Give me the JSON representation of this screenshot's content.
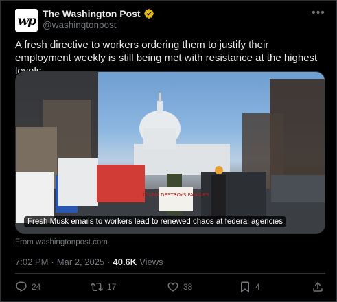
{
  "account": {
    "display_name": "The Washington Post",
    "handle": "@washingtonpost",
    "avatar_text": "wp",
    "verified": true,
    "verified_color": "#e2b719"
  },
  "more_icon": "more-icon",
  "post": {
    "text": "A fresh directive to workers ordering them to justify their employment weekly is still being met with resistance at the highest levels."
  },
  "media": {
    "caption": "Fresh Musk emails to workers lead to renewed chaos at federal agencies",
    "sign_text": "TRUMP DESTROYS FAMILIES",
    "source": "From washingtonpost.com"
  },
  "meta": {
    "time": "7:02 PM",
    "separator": "·",
    "date": "Mar 2, 2025",
    "views_count": "40.6K",
    "views_label": "Views"
  },
  "actions": {
    "replies": "24",
    "reposts": "17",
    "likes": "38",
    "bookmarks": "4"
  },
  "colors": {
    "background": "#000000",
    "text": "#e7e9ea",
    "secondary": "#71767b",
    "border": "#2f3336"
  }
}
